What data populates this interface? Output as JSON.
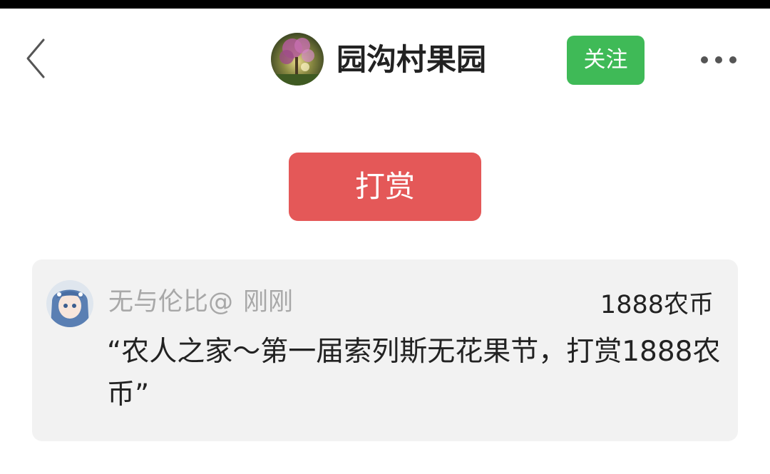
{
  "header": {
    "back_icon": "chevron-left-icon",
    "avatar_icon": "flower-tree-avatar",
    "title": "园沟村果园",
    "follow_label": "关注",
    "more_icon": "more-dots-icon"
  },
  "reward": {
    "button_label": "打赏"
  },
  "record": {
    "avatar_icon": "anime-girl-avatar",
    "user_name": "无与伦比@",
    "time": "刚刚",
    "amount": "1888农币",
    "message": "“农人之家～第一届索列斯无花果节，打赏1888农币”"
  },
  "colors": {
    "follow_green": "#3fba57",
    "reward_red": "#e45858",
    "card_bg": "#f2f2f2",
    "muted_text": "#a8a8a8"
  }
}
